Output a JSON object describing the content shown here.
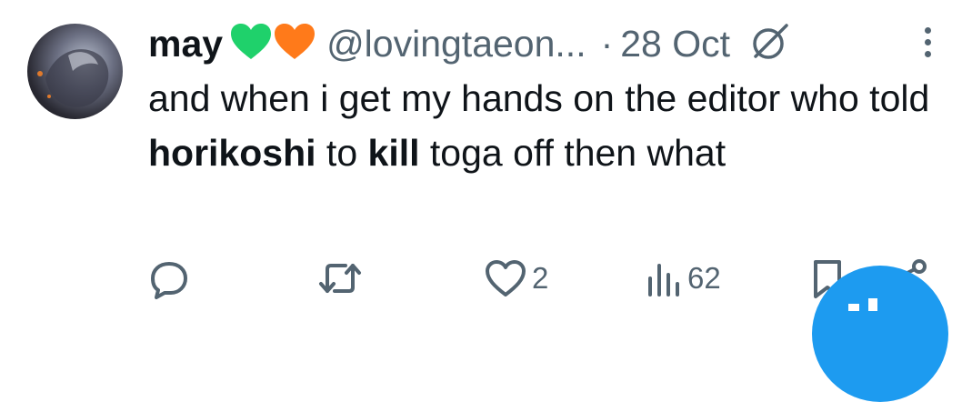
{
  "tweet": {
    "display_name": "may",
    "emojis": [
      "green-heart-icon",
      "orange-heart-icon"
    ],
    "handle": "@lovingtaeon...",
    "separator": "·",
    "date": "28 Oct",
    "text_segments": [
      {
        "text": "and when i get my hands on the editor who told ",
        "bold": false
      },
      {
        "text": "horikoshi",
        "bold": true
      },
      {
        "text": " to ",
        "bold": false
      },
      {
        "text": "kill",
        "bold": true
      },
      {
        "text": " toga off then what",
        "bold": false
      }
    ]
  },
  "actions": {
    "reply_count": "",
    "retweet_count": "",
    "like_count": "2",
    "views_count": "62"
  },
  "colors": {
    "text": "#0f1419",
    "secondary": "#536471",
    "accent": "#1d9bf0",
    "heart_green": "#1fd16b",
    "heart_orange": "#ff7a1a"
  }
}
